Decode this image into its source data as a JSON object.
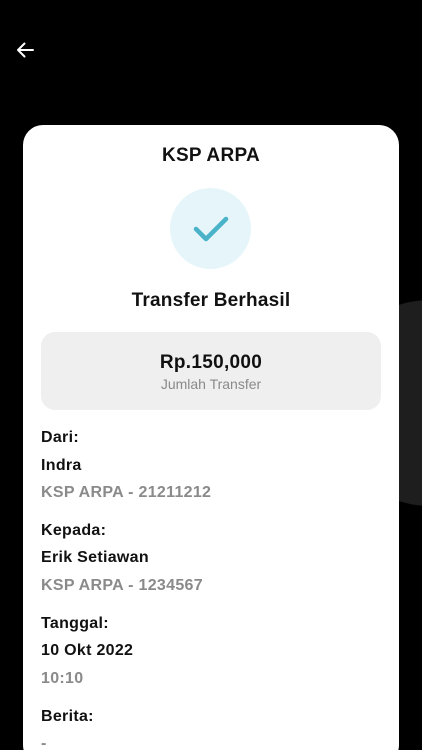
{
  "header": {
    "back_icon": "arrow-left-icon"
  },
  "card": {
    "org_name": "KSP ARPA",
    "status_icon": "checkmark-icon",
    "status_title": "Transfer Berhasil",
    "amount": {
      "value": "Rp.150,000",
      "label": "Jumlah Transfer"
    },
    "from": {
      "label": "Dari:",
      "name": "Indra",
      "account": "KSP ARPA - 21211212"
    },
    "to": {
      "label": "Kepada:",
      "name": "Erik Setiawan",
      "account": "KSP ARPA - 1234567"
    },
    "date": {
      "label": "Tanggal:",
      "date": "10 Okt 2022",
      "time": "10:10"
    },
    "message": {
      "label": "Berita:",
      "value": "-"
    }
  },
  "colors": {
    "background": "#000000",
    "card": "#ffffff",
    "accent": "#4ab3c9",
    "check_bg": "#e5f5fa",
    "muted_text": "#8a8a8a"
  }
}
